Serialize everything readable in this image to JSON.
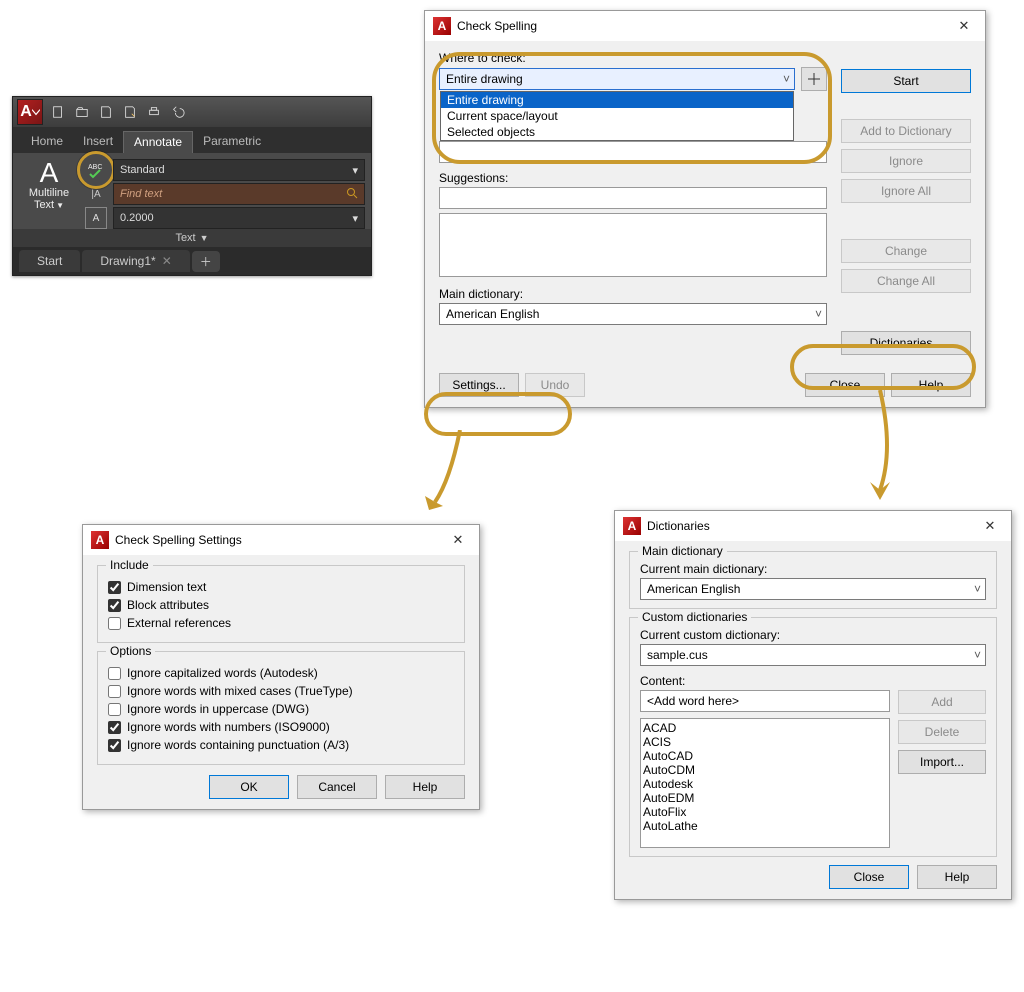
{
  "ribbon": {
    "tabs": [
      "Home",
      "Insert",
      "Annotate",
      "Parametric"
    ],
    "active_tab": "Annotate",
    "multiline_label_1": "Multiline",
    "multiline_label_2": "Text",
    "standard": "Standard",
    "find_placeholder": "Find text",
    "height_value": "0.2000",
    "panel_label": "Text",
    "file_tabs": [
      {
        "label": "Start",
        "closable": false
      },
      {
        "label": "Drawing1*",
        "closable": true
      }
    ]
  },
  "spell": {
    "title": "Check Spelling",
    "where_label": "Where to check:",
    "where_value": "Entire drawing",
    "where_options": [
      "Entire drawing",
      "Current space/layout",
      "Selected objects"
    ],
    "start": "Start",
    "sugg_label": "Suggestions:",
    "add_dict": "Add to Dictionary",
    "ignore": "Ignore",
    "ignore_all": "Ignore All",
    "change": "Change",
    "change_all": "Change All",
    "main_dict_label": "Main dictionary:",
    "main_dict_value": "American English",
    "dictionaries_btn": "Dictionaries...",
    "settings_btn": "Settings...",
    "undo_btn": "Undo",
    "close_btn": "Close",
    "help_btn": "Help"
  },
  "cfg": {
    "title": "Check Spelling Settings",
    "include_title": "Include",
    "inc_dim": "Dimension text",
    "inc_blk": "Block attributes",
    "inc_xref": "External references",
    "options_title": "Options",
    "opt_cap": "Ignore capitalized words (Autodesk)",
    "opt_mixed": "Ignore words with mixed cases (TrueType)",
    "opt_upper": "Ignore words in uppercase (DWG)",
    "opt_num": "Ignore words with numbers (ISO9000)",
    "opt_punct": "Ignore words containing punctuation (A/3)",
    "ok": "OK",
    "cancel": "Cancel",
    "help": "Help"
  },
  "dict": {
    "title": "Dictionaries",
    "main_grp": "Main dictionary",
    "main_lbl": "Current main dictionary:",
    "main_val": "American English",
    "cust_grp": "Custom dictionaries",
    "cust_lbl": "Current custom dictionary:",
    "cust_val": "sample.cus",
    "content_lbl": "Content:",
    "add_placeholder": "<Add word here>",
    "words": [
      "ACAD",
      "ACIS",
      "AutoCAD",
      "AutoCDM",
      "Autodesk",
      "AutoEDM",
      "AutoFlix",
      "AutoLathe"
    ],
    "add": "Add",
    "delete": "Delete",
    "import": "Import...",
    "close": "Close",
    "help": "Help"
  }
}
